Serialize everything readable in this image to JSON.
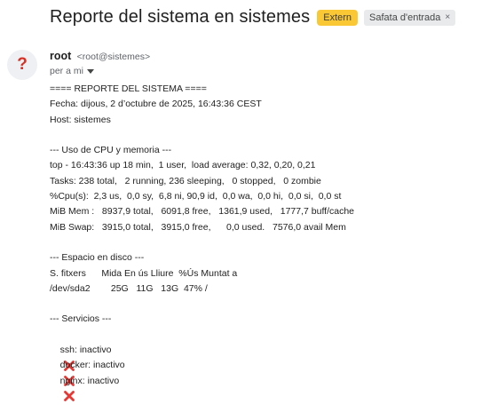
{
  "header": {
    "subject": "Reporte del sistema en sistemes",
    "badge_extern": "Extern",
    "badge_inbox": "Safata d'entrada",
    "badge_inbox_close": "×"
  },
  "sender": {
    "avatar": "?",
    "name": "root",
    "email": "<root@sistemes>",
    "to": "per a mi"
  },
  "body": {
    "lines": [
      "==== REPORTE DEL SISTEMA ====",
      "Fecha: dijous, 2 d’octubre de 2025, 16:43:36 CEST",
      "Host: sistemes",
      "",
      "--- Uso de CPU y memoria ---",
      "top - 16:43:36 up 18 min,  1 user,  load average: 0,32, 0,20, 0,21",
      "Tasks: 238 total,   2 running, 236 sleeping,   0 stopped,   0 zombie",
      "%Cpu(s):  2,3 us,  0,0 sy,  6,8 ni, 90,9 id,  0,0 wa,  0,0 hi,  0,0 si,  0,0 st",
      "MiB Mem :   8937,9 total,   6091,8 free,   1361,9 used,   1777,7 buff/cache",
      "MiB Swap:   3915,0 total,   3915,0 free,      0,0 used.   7576,0 avail Mem",
      "",
      "--- Espacio en disco ---",
      "S. fitxers      Mida En ús Lliure  %Ús Muntat a",
      "/dev/sda2        25G   11G   13G  47% /",
      "",
      "--- Servicios ---"
    ],
    "services": [
      {
        "text": "ssh: inactivo",
        "icon": "red-cross-icon"
      },
      {
        "text": "docker: inactivo",
        "icon": "red-cross-icon"
      },
      {
        "text": "nginx: inactivo",
        "icon": "red-cross-icon"
      }
    ]
  },
  "colors": {
    "extern_badge": "#f9c834",
    "inbox_badge": "#e9eaec",
    "cross": "#e53935",
    "avatar_question": "#d93025"
  }
}
